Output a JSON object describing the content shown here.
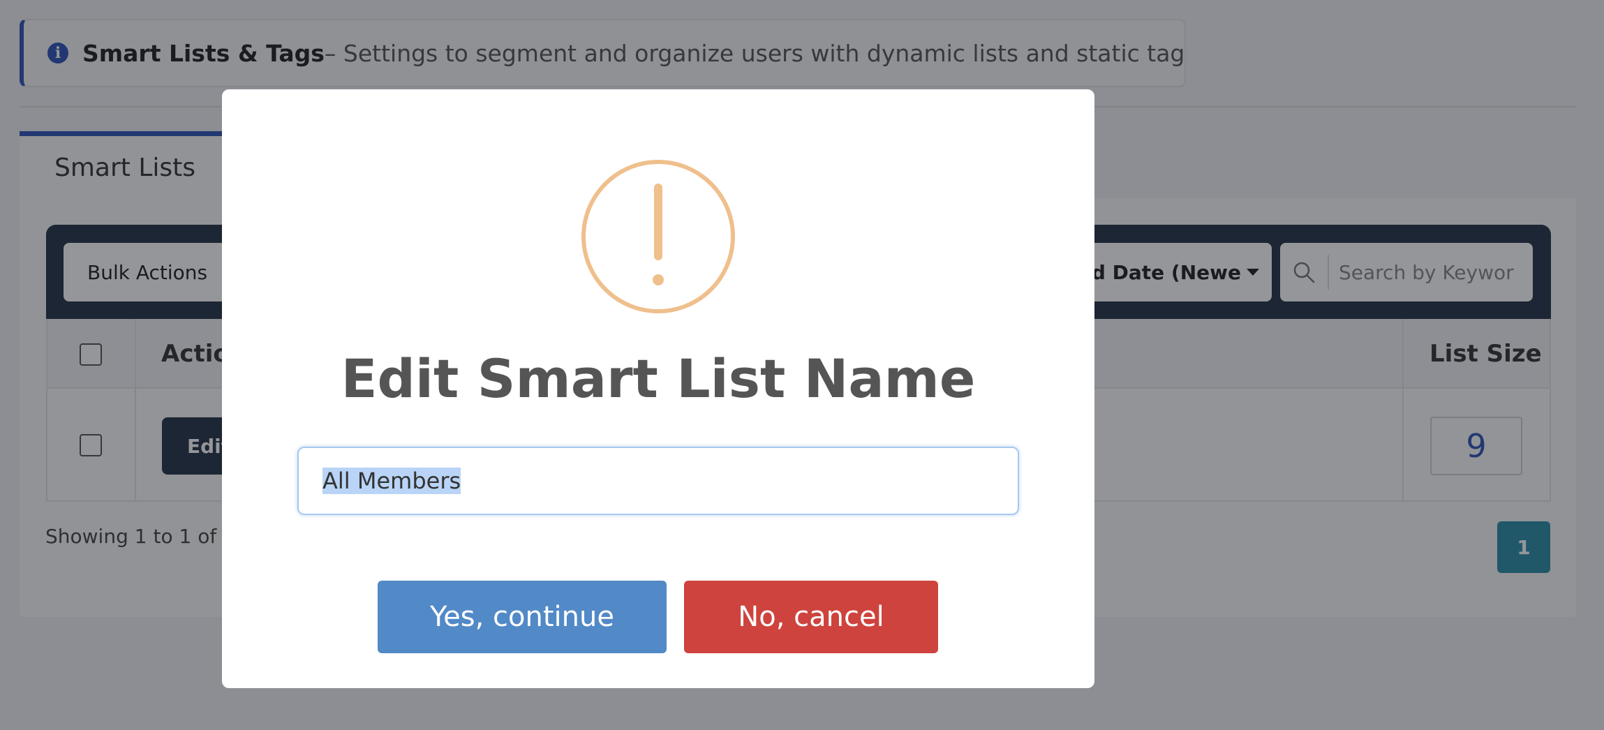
{
  "notice": {
    "title": "Smart Lists & Tags",
    "text": " – Settings to segment and organize users with dynamic lists and static tags.",
    "icon": "info-icon"
  },
  "tabs": [
    {
      "label": "Smart Lists"
    }
  ],
  "toolbar": {
    "bulk_actions_label": "Bulk Actions",
    "sort_label": "ed Date (Newe",
    "search_placeholder": "Search by Keywor"
  },
  "table": {
    "headers": {
      "action": "Actio",
      "list_size": "List Size"
    },
    "rows": [
      {
        "action_button": "Edit",
        "list_size": "9"
      }
    ]
  },
  "footer": {
    "showing_text": "Showing 1 to 1 of 1",
    "current_page": "1"
  },
  "modal": {
    "icon": "exclamation-circle-icon",
    "title": "Edit Smart List Name",
    "input_value": "All Members",
    "confirm_label": "Yes, continue",
    "cancel_label": "No, cancel"
  },
  "colors": {
    "primary": "#2c55b8",
    "dark_toolbar": "#243448",
    "confirm": "#5289c7",
    "cancel": "#ce433d",
    "warning": "#efbf8c",
    "pagination": "#2a8fa8"
  }
}
